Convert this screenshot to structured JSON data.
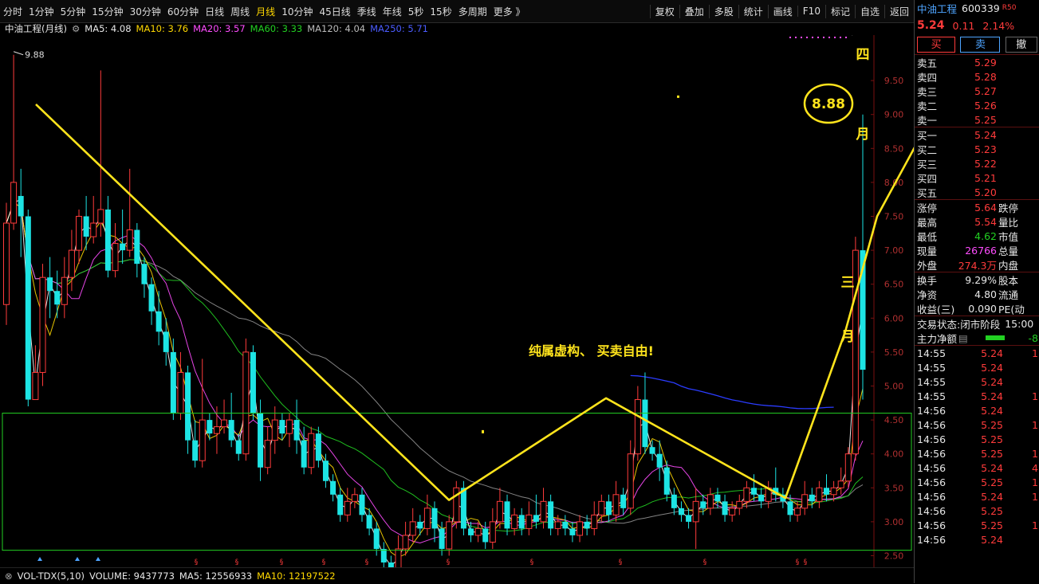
{
  "toolbar": {
    "timeframes": [
      "分时",
      "1分钟",
      "5分钟",
      "15分钟",
      "30分钟",
      "60分钟",
      "日线",
      "周线",
      "月线",
      "10分钟",
      "45日线",
      "季线",
      "年线",
      "5秒",
      "15秒",
      "多周期",
      "更多 》"
    ],
    "active_timeframe": "月线",
    "buttons": [
      "复权",
      "叠加",
      "多股",
      "统计",
      "画线",
      "F10",
      "标记",
      "自选",
      "返回"
    ]
  },
  "legend": {
    "title": "中油工程(月线)",
    "ma5": "MA5: 4.08",
    "ma10": "MA10: 3.76",
    "ma20": "MA20: 3.57",
    "ma60": "MA60: 3.33",
    "ma120": "MA120: 4.04",
    "ma250": "MA250: 5.71"
  },
  "chart_data": {
    "type": "candlestick",
    "ylim": [
      2.4,
      10.1
    ],
    "y_ticks": [
      "9.50",
      "9.00",
      "8.50",
      "8.00",
      "7.50",
      "7.00",
      "6.50",
      "6.00",
      "5.50",
      "5.00",
      "4.50",
      "4.00",
      "3.50",
      "3.00",
      "2.50"
    ],
    "high_label": "9.88",
    "low_label": "2.25",
    "candles": [
      [
        6.2,
        7.4,
        7.7,
        5.9
      ],
      [
        7.4,
        8.0,
        9.88,
        7.3
      ],
      [
        7.8,
        7.5,
        8.2,
        6.9
      ],
      [
        7.5,
        4.8,
        7.6,
        4.7
      ],
      [
        4.8,
        5.2,
        5.6,
        4.8
      ],
      [
        5.2,
        6.6,
        6.8,
        5.0
      ],
      [
        6.6,
        6.4,
        6.9,
        6.0
      ],
      [
        6.4,
        6.2,
        6.7,
        6.0
      ],
      [
        6.2,
        6.6,
        6.9,
        6.0
      ],
      [
        6.6,
        7.0,
        7.3,
        6.4
      ],
      [
        7.0,
        7.5,
        7.6,
        6.8
      ],
      [
        7.5,
        7.2,
        7.8,
        7.0
      ],
      [
        7.2,
        7.4,
        7.8,
        7.1
      ],
      [
        7.4,
        7.6,
        9.65,
        7.2
      ],
      [
        7.6,
        6.7,
        7.8,
        6.6
      ],
      [
        6.7,
        7.1,
        7.4,
        6.6
      ],
      [
        7.1,
        7.0,
        7.6,
        6.8
      ],
      [
        7.0,
        7.3,
        8.2,
        6.9
      ],
      [
        7.3,
        6.8,
        7.4,
        6.6
      ],
      [
        6.8,
        6.5,
        6.9,
        6.3
      ],
      [
        6.5,
        6.1,
        6.6,
        5.9
      ],
      [
        6.1,
        5.8,
        6.4,
        5.6
      ],
      [
        5.8,
        5.5,
        6.0,
        5.3
      ],
      [
        5.5,
        4.6,
        5.7,
        4.5
      ],
      [
        4.6,
        5.2,
        5.5,
        4.5
      ],
      [
        5.2,
        4.2,
        5.3,
        4.0
      ],
      [
        4.2,
        3.9,
        4.5,
        3.8
      ],
      [
        3.9,
        4.5,
        5.4,
        3.8
      ],
      [
        4.5,
        4.3,
        4.6,
        4.2
      ],
      [
        4.3,
        4.4,
        4.7,
        4.0
      ],
      [
        4.4,
        4.5,
        4.8,
        4.3
      ],
      [
        4.5,
        4.2,
        4.9,
        4.1
      ],
      [
        4.2,
        4.0,
        4.3,
        3.9
      ],
      [
        4.0,
        5.5,
        5.7,
        3.9
      ],
      [
        5.5,
        4.6,
        5.6,
        4.5
      ],
      [
        4.6,
        3.8,
        4.8,
        3.6
      ],
      [
        3.8,
        4.2,
        4.4,
        3.7
      ],
      [
        4.2,
        4.5,
        4.7,
        4.0
      ],
      [
        4.5,
        4.3,
        4.6,
        4.2
      ],
      [
        4.3,
        4.5,
        4.6,
        4.1
      ],
      [
        4.5,
        4.2,
        4.8,
        4.0
      ],
      [
        4.2,
        3.8,
        4.4,
        3.7
      ],
      [
        3.8,
        4.3,
        4.4,
        3.7
      ],
      [
        4.3,
        3.9,
        4.4,
        3.8
      ],
      [
        3.9,
        3.6,
        4.0,
        3.5
      ],
      [
        3.6,
        3.4,
        3.7,
        3.3
      ],
      [
        3.4,
        3.1,
        3.5,
        3.0
      ],
      [
        3.1,
        3.3,
        3.5,
        3.0
      ],
      [
        3.3,
        3.4,
        3.5,
        3.2
      ],
      [
        3.4,
        3.1,
        3.5,
        3.0
      ],
      [
        3.1,
        2.9,
        3.2,
        2.8
      ],
      [
        2.9,
        2.6,
        3.0,
        2.5
      ],
      [
        2.6,
        2.4,
        2.7,
        2.3
      ],
      [
        2.4,
        2.3,
        2.5,
        2.25
      ],
      [
        2.3,
        2.6,
        2.8,
        2.25
      ],
      [
        2.6,
        2.8,
        3.0,
        2.5
      ],
      [
        2.8,
        3.0,
        3.2,
        2.7
      ],
      [
        3.0,
        2.9,
        3.1,
        2.8
      ],
      [
        2.9,
        3.2,
        3.4,
        2.8
      ],
      [
        3.2,
        2.9,
        3.3,
        2.7
      ],
      [
        2.9,
        2.6,
        3.0,
        2.5
      ],
      [
        2.6,
        3.0,
        3.1,
        2.5
      ],
      [
        3.0,
        3.5,
        3.6,
        2.9
      ],
      [
        3.5,
        2.9,
        3.6,
        2.8
      ],
      [
        2.9,
        2.8,
        3.0,
        2.7
      ],
      [
        2.8,
        2.9,
        3.0,
        2.7
      ],
      [
        2.9,
        2.7,
        3.0,
        2.6
      ],
      [
        2.7,
        3.0,
        3.2,
        2.6
      ],
      [
        3.0,
        3.3,
        3.5,
        2.9
      ],
      [
        3.3,
        2.9,
        3.4,
        2.8
      ],
      [
        2.9,
        3.1,
        3.2,
        2.8
      ],
      [
        3.1,
        2.9,
        3.2,
        2.8
      ],
      [
        2.9,
        3.1,
        3.3,
        2.8
      ],
      [
        3.1,
        3.0,
        3.4,
        2.9
      ],
      [
        3.0,
        3.3,
        3.5,
        2.9
      ],
      [
        3.3,
        2.9,
        3.4,
        2.8
      ],
      [
        2.9,
        3.0,
        3.1,
        2.8
      ],
      [
        3.0,
        2.9,
        3.1,
        2.8
      ],
      [
        2.9,
        2.8,
        3.0,
        2.7
      ],
      [
        2.8,
        3.0,
        3.1,
        2.7
      ],
      [
        3.0,
        2.9,
        3.1,
        2.8
      ],
      [
        2.9,
        3.1,
        3.3,
        2.8
      ],
      [
        3.1,
        3.3,
        3.4,
        3.0
      ],
      [
        3.3,
        3.1,
        3.4,
        3.0
      ],
      [
        3.1,
        3.4,
        3.6,
        3.0
      ],
      [
        3.4,
        3.2,
        3.5,
        3.1
      ],
      [
        3.2,
        4.0,
        4.2,
        3.1
      ],
      [
        4.0,
        4.8,
        5.0,
        3.9
      ],
      [
        4.8,
        4.1,
        5.2,
        4.0
      ],
      [
        4.1,
        4.0,
        4.2,
        3.9
      ],
      [
        4.0,
        3.8,
        4.2,
        3.6
      ],
      [
        3.8,
        3.4,
        3.9,
        3.3
      ],
      [
        3.4,
        3.2,
        3.5,
        3.1
      ],
      [
        3.2,
        3.1,
        3.3,
        3.0
      ],
      [
        3.1,
        3.0,
        3.2,
        2.9
      ],
      [
        3.0,
        3.3,
        3.5,
        2.6
      ],
      [
        3.3,
        3.2,
        3.4,
        3.1
      ],
      [
        3.2,
        3.4,
        3.5,
        3.1
      ],
      [
        3.4,
        3.3,
        3.5,
        3.2
      ],
      [
        3.3,
        3.1,
        3.4,
        3.0
      ],
      [
        3.1,
        3.2,
        3.3,
        3.0
      ],
      [
        3.2,
        3.3,
        3.4,
        3.1
      ],
      [
        3.3,
        3.5,
        3.6,
        3.2
      ],
      [
        3.5,
        3.4,
        3.7,
        3.3
      ],
      [
        3.4,
        3.3,
        3.5,
        3.2
      ],
      [
        3.3,
        3.5,
        3.6,
        3.2
      ],
      [
        3.5,
        3.4,
        3.8,
        3.3
      ],
      [
        3.4,
        3.3,
        3.5,
        3.2
      ],
      [
        3.3,
        3.1,
        3.4,
        3.0
      ],
      [
        3.1,
        3.2,
        3.3,
        3.0
      ],
      [
        3.2,
        3.4,
        3.6,
        3.1
      ],
      [
        3.4,
        3.3,
        3.5,
        3.2
      ],
      [
        3.3,
        3.5,
        3.6,
        3.2
      ],
      [
        3.5,
        3.4,
        3.7,
        3.3
      ],
      [
        3.4,
        3.5,
        3.6,
        3.3
      ],
      [
        3.5,
        3.6,
        3.8,
        3.4
      ],
      [
        3.6,
        4.0,
        4.1,
        3.5
      ],
      [
        4.0,
        7.0,
        7.2,
        3.9
      ],
      [
        7.0,
        5.24,
        9.0,
        4.8
      ]
    ],
    "ma_colors": {
      "ma5": "#ffffff",
      "ma10": "#ffd800",
      "ma20": "#ff4cff",
      "ma60": "#22d122",
      "ma120": "#bbbbbb",
      "ma250": "#2b3cff"
    },
    "support_box": {
      "top": 4.6,
      "bottom": 2.58
    },
    "trendline_points": [
      [
        45,
        9.15
      ],
      [
        563,
        3.32
      ],
      [
        760,
        4.82
      ],
      [
        985,
        3.35
      ],
      [
        1060,
        5.8
      ],
      [
        1100,
        7.5
      ],
      [
        1225,
        10.2
      ]
    ],
    "annotations": {
      "circle_text": "8.88",
      "note_text": "纯属虚构、 买卖自由!",
      "month4_a": "四",
      "month4_b": "月",
      "month3_a": "三",
      "month3_b": "月"
    }
  },
  "vol_legend": {
    "title": "VOL-TDX(5,10)",
    "volume": "VOLUME: 9437773",
    "ma5": "MA5: 12556933",
    "ma10": "MA10: 12197522"
  },
  "panel": {
    "stock_name": "中油工程",
    "stock_code": "600339",
    "badge": "R50",
    "price": "5.24",
    "change": "0.11",
    "change_pct": "2.14%",
    "buy_label": "买",
    "sell_label": "卖",
    "cancel_label": "撤",
    "asks": [
      [
        "卖五",
        "5.29"
      ],
      [
        "卖四",
        "5.28"
      ],
      [
        "卖三",
        "5.27"
      ],
      [
        "卖二",
        "5.26"
      ],
      [
        "卖一",
        "5.25"
      ]
    ],
    "bids": [
      [
        "买一",
        "5.24"
      ],
      [
        "买二",
        "5.23"
      ],
      [
        "买三",
        "5.22"
      ],
      [
        "买四",
        "5.21"
      ],
      [
        "买五",
        "5.20"
      ]
    ],
    "stats1": [
      {
        "k": "涨停",
        "v": "5.64",
        "k2": "跌停"
      },
      {
        "k": "最高",
        "v": "5.54",
        "k2": "量比"
      },
      {
        "k": "最低",
        "v": "4.62",
        "k2": "市值"
      },
      {
        "k": "现量",
        "v": "26766",
        "k2": "总量"
      },
      {
        "k": "外盘",
        "v": "274.3万",
        "k2": "内盘"
      }
    ],
    "stats2": [
      {
        "k": "换手",
        "v": "9.29%",
        "k2": "股本"
      },
      {
        "k": "净资",
        "v": "4.80",
        "k2": "流通"
      },
      {
        "k": "收益(三)",
        "v": "0.090",
        "k2": "PE(动"
      }
    ],
    "trade_status_label": "交易状态:",
    "trade_status": "闭市阶段",
    "trade_time": "15:00",
    "main_flow_label": "主力净额",
    "main_flow_value": "-8",
    "ticks": [
      [
        "14:55",
        "5.24",
        "1"
      ],
      [
        "14:55",
        "5.24",
        ""
      ],
      [
        "14:55",
        "5.24",
        ""
      ],
      [
        "14:55",
        "5.24",
        "1"
      ],
      [
        "14:56",
        "5.24",
        ""
      ],
      [
        "14:56",
        "5.25",
        "1"
      ],
      [
        "14:56",
        "5.25",
        ""
      ],
      [
        "14:56",
        "5.25",
        "1"
      ],
      [
        "14:56",
        "5.24",
        "4"
      ],
      [
        "14:56",
        "5.25",
        "1"
      ],
      [
        "14:56",
        "5.24",
        "1"
      ],
      [
        "14:56",
        "5.25",
        ""
      ],
      [
        "14:56",
        "5.25",
        "1"
      ],
      [
        "14:56",
        "5.24",
        ""
      ]
    ]
  }
}
